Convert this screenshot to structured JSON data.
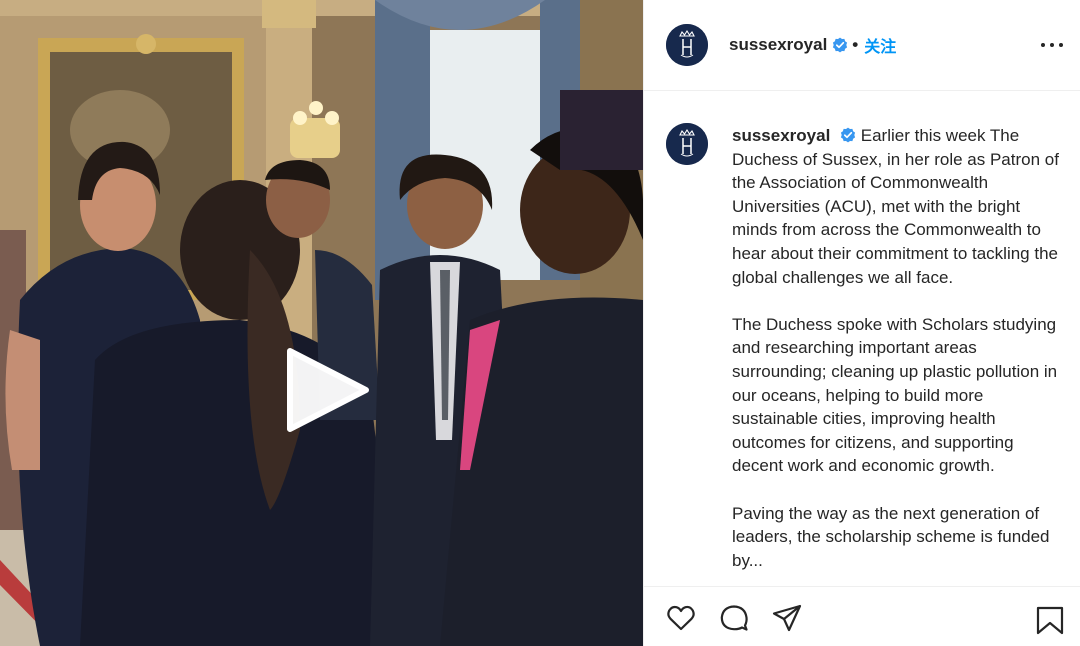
{
  "post": {
    "username": "sussexroyal",
    "verified": true,
    "separator": "•",
    "follow_label": "关注",
    "more_icon": "more-horizontal-icon",
    "avatar_icon": "crowned-monogram-icon"
  },
  "media": {
    "type": "video",
    "play_icon": "play-icon"
  },
  "caption": {
    "username": "sussexroyal",
    "paragraphs": [
      "Earlier this week The Duchess of Sussex, in her role as Patron of the Association of Commonwealth Universities (ACU), met with the bright minds from across the Commonwealth to hear about their commitment to tackling the global challenges we all face.",
      "The Duchess spoke with Scholars studying and researching important areas surrounding; cleaning up plastic pollution in our oceans, helping to build more sustainable cities, improving health outcomes for citizens, and supporting decent work and economic growth.",
      "Paving the way as the next generation of leaders, the scholarship scheme is funded by..."
    ]
  },
  "actions": {
    "like_icon": "heart-icon",
    "comment_icon": "comment-icon",
    "share_icon": "share-icon",
    "save_icon": "bookmark-icon"
  },
  "colors": {
    "link_blue": "#0095f6",
    "avatar_navy": "#17294d",
    "verified_blue": "#3897f0",
    "text": "#262626",
    "divider": "#efefef"
  }
}
